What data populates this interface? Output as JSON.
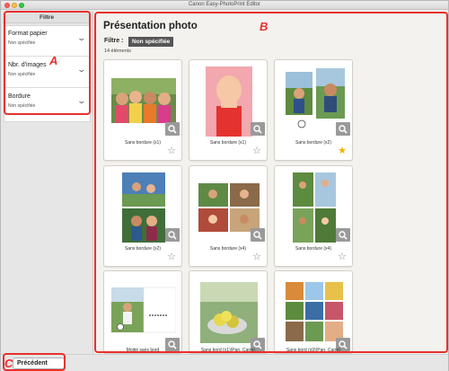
{
  "window": {
    "title": "Canon Easy-PhotoPrint Editor"
  },
  "sidebar": {
    "heading": "Filtre",
    "filters": [
      {
        "label": "Format papier",
        "value": "Non spécifiée"
      },
      {
        "label": "Nbr. d'images",
        "value": "Non spécifiée"
      },
      {
        "label": "Bordure",
        "value": "Non spécifiée"
      }
    ]
  },
  "main": {
    "title": "Présentation photo",
    "filter_label": "Filtre :",
    "filter_value": "Non spécifiée",
    "count": "14 éléments",
    "layouts": [
      {
        "caption": "Sans bordure (x1)",
        "favorite": false
      },
      {
        "caption": "Sans bordure (x1)",
        "favorite": false
      },
      {
        "caption": "Sans bordure (x2)",
        "favorite": true
      },
      {
        "caption": "Sans bordure (x2)",
        "favorite": false
      },
      {
        "caption": "Sans bordure (x4)",
        "favorite": false
      },
      {
        "caption": "Sans bordure (x4)",
        "favorite": false
      },
      {
        "caption": "Moitié sans bord",
        "favorite": false
      },
      {
        "caption": "Sans bord (x1)(Pan. Carré)",
        "favorite": false
      },
      {
        "caption": "Sans bord (x9)(Pan. Carré)",
        "favorite": false
      }
    ]
  },
  "footer": {
    "back_label": "Précédent"
  },
  "callouts": {
    "a": "A",
    "b": "B",
    "c": "C"
  },
  "colors": {
    "callout": "#e8302e",
    "favorite_star": "#f5b301",
    "badge_bg": "#555555"
  }
}
